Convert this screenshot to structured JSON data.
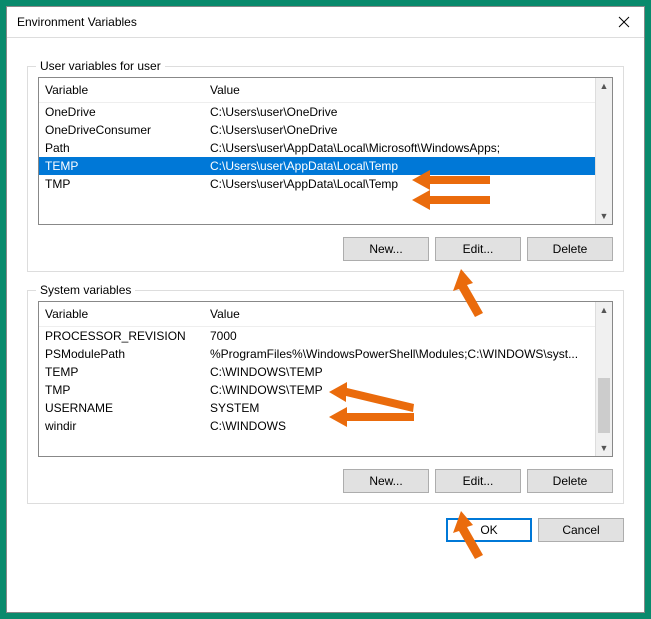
{
  "window": {
    "title": "Environment Variables"
  },
  "userGroup": {
    "label": "User variables for user",
    "headers": {
      "variable": "Variable",
      "value": "Value"
    },
    "rows": [
      {
        "variable": "OneDrive",
        "value": "C:\\Users\\user\\OneDrive",
        "selected": false
      },
      {
        "variable": "OneDriveConsumer",
        "value": "C:\\Users\\user\\OneDrive",
        "selected": false
      },
      {
        "variable": "Path",
        "value": "C:\\Users\\user\\AppData\\Local\\Microsoft\\WindowsApps;",
        "selected": false
      },
      {
        "variable": "TEMP",
        "value": "C:\\Users\\user\\AppData\\Local\\Temp",
        "selected": true
      },
      {
        "variable": "TMP",
        "value": "C:\\Users\\user\\AppData\\Local\\Temp",
        "selected": false
      }
    ],
    "buttons": {
      "new": "New...",
      "edit": "Edit...",
      "delete": "Delete"
    }
  },
  "systemGroup": {
    "label": "System variables",
    "headers": {
      "variable": "Variable",
      "value": "Value"
    },
    "rows": [
      {
        "variable": "PROCESSOR_REVISION",
        "value": "7000",
        "selected": false
      },
      {
        "variable": "PSModulePath",
        "value": "%ProgramFiles%\\WindowsPowerShell\\Modules;C:\\WINDOWS\\syst...",
        "selected": false
      },
      {
        "variable": "TEMP",
        "value": "C:\\WINDOWS\\TEMP",
        "selected": false
      },
      {
        "variable": "TMP",
        "value": "C:\\WINDOWS\\TEMP",
        "selected": false
      },
      {
        "variable": "USERNAME",
        "value": "SYSTEM",
        "selected": false
      },
      {
        "variable": "windir",
        "value": "C:\\WINDOWS",
        "selected": false
      }
    ],
    "buttons": {
      "new": "New...",
      "edit": "Edit...",
      "delete": "Delete"
    }
  },
  "footer": {
    "ok": "OK",
    "cancel": "Cancel"
  }
}
